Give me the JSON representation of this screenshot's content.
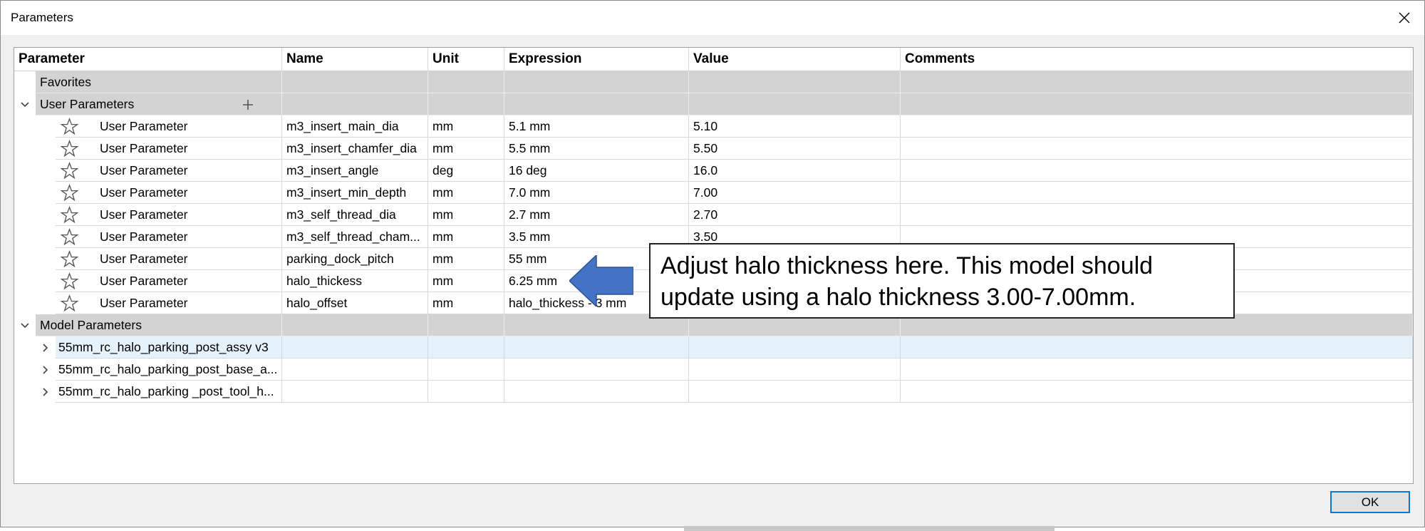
{
  "window": {
    "title": "Parameters"
  },
  "columns": [
    "Parameter",
    "Name",
    "Unit",
    "Expression",
    "Value",
    "Comments"
  ],
  "groups": {
    "favorites": "Favorites",
    "user": "User Parameters",
    "model": "Model Parameters"
  },
  "user_params": [
    {
      "type": "User Parameter",
      "name": "m3_insert_main_dia",
      "unit": "mm",
      "expression": "5.1 mm",
      "value": "5.10",
      "comment": ""
    },
    {
      "type": "User Parameter",
      "name": "m3_insert_chamfer_dia",
      "unit": "mm",
      "expression": "5.5 mm",
      "value": "5.50",
      "comment": ""
    },
    {
      "type": "User Parameter",
      "name": "m3_insert_angle",
      "unit": "deg",
      "expression": "16 deg",
      "value": "16.0",
      "comment": ""
    },
    {
      "type": "User Parameter",
      "name": "m3_insert_min_depth",
      "unit": "mm",
      "expression": "7.0 mm",
      "value": "7.00",
      "comment": ""
    },
    {
      "type": "User Parameter",
      "name": "m3_self_thread_dia",
      "unit": "mm",
      "expression": "2.7 mm",
      "value": "2.70",
      "comment": ""
    },
    {
      "type": "User Parameter",
      "name": "m3_self_thread_cham...",
      "unit": "mm",
      "expression": "3.5 mm",
      "value": "3.50",
      "comment": ""
    },
    {
      "type": "User Parameter",
      "name": "parking_dock_pitch",
      "unit": "mm",
      "expression": "55 mm",
      "value": "",
      "comment": ""
    },
    {
      "type": "User Parameter",
      "name": "halo_thickess",
      "unit": "mm",
      "expression": "6.25 mm",
      "value": "",
      "comment": ""
    },
    {
      "type": "User Parameter",
      "name": "halo_offset",
      "unit": "mm",
      "expression": "halo_thickess - 3 mm",
      "value": "",
      "comment": ""
    }
  ],
  "model_params": [
    {
      "label": "55mm_rc_halo_parking_post_assy v3"
    },
    {
      "label": "55mm_rc_halo_parking_post_base_a..."
    },
    {
      "label": "55mm_rc_halo_parking _post_tool_h..."
    }
  ],
  "callout": {
    "line1": "Adjust halo thickness here.  This model should",
    "line2": "update using a halo thickness 3.00-7.00mm."
  },
  "buttons": {
    "ok": "OK"
  },
  "colors": {
    "group_bg": "#d3d3d3",
    "selected_row": "#e5f1fb",
    "arrow": "#4472c4",
    "ok_border": "#0078d7"
  }
}
